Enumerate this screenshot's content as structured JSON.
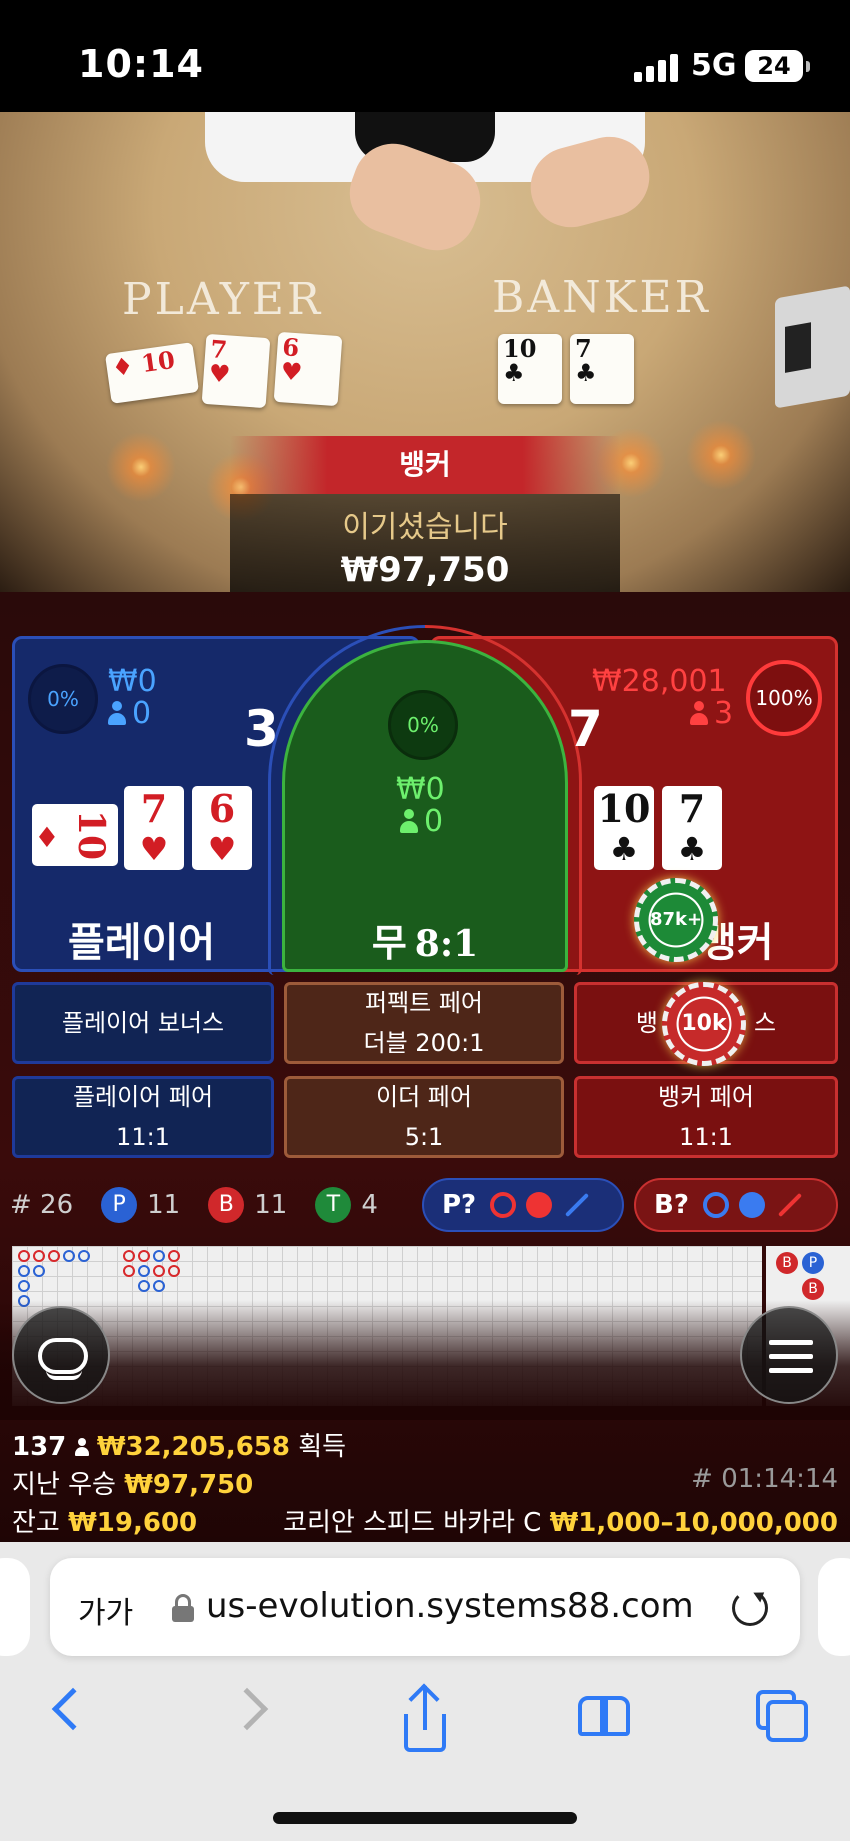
{
  "status_bar": {
    "time": "10:14",
    "network": "5G",
    "battery": "24"
  },
  "video": {
    "player_label": "PLAYER",
    "banker_label": "BANKER",
    "player_cards": [
      {
        "rank": "10",
        "suit": "♦",
        "color": "red"
      },
      {
        "rank": "7",
        "suit": "♥",
        "color": "red"
      },
      {
        "rank": "6",
        "suit": "♥",
        "color": "red"
      }
    ],
    "banker_cards": [
      {
        "rank": "10",
        "suit": "♣",
        "color": "black"
      },
      {
        "rank": "7",
        "suit": "♣",
        "color": "black"
      }
    ],
    "result_winner": "뱅커",
    "result_message": "이기셨습니다",
    "result_amount": "₩97,750"
  },
  "player_box": {
    "percent": "0%",
    "amount": "₩0",
    "count": "0",
    "score": "3",
    "title": "플레이어",
    "cards": [
      {
        "rank": "10",
        "suit": "♦"
      },
      {
        "rank": "7",
        "suit": "♥"
      },
      {
        "rank": "6",
        "suit": "♥"
      }
    ]
  },
  "tie_box": {
    "percent": "0%",
    "amount": "₩0",
    "count": "0",
    "title": "무",
    "odds": "8:1"
  },
  "banker_box": {
    "percent": "100%",
    "amount": "₩28,001",
    "count": "3",
    "score": "7",
    "title": "뱅커",
    "cards": [
      {
        "rank": "10",
        "suit": "♣"
      },
      {
        "rank": "7",
        "suit": "♣"
      }
    ],
    "chip_label": "87k+"
  },
  "side_bets": {
    "player_bonus": "플레이어 보너스",
    "perfect_pair": "퍼펙트 페어",
    "perfect_pair_odds": "더블 200:1",
    "banker_bonus_prefix": "뱅",
    "banker_bonus_suffix": "스",
    "banker_bonus_chip": "10k",
    "player_pair": "플레이어 페어",
    "player_pair_odds": "11:1",
    "either_pair": "이더 페어",
    "either_pair_odds": "5:1",
    "banker_pair": "뱅커 페어",
    "banker_pair_odds": "11:1"
  },
  "road_stats": {
    "round_number": "# 26",
    "p_badge": "P",
    "p_count": "11",
    "b_badge": "B",
    "b_count": "11",
    "t_badge": "T",
    "t_count": "4",
    "p_predict": "P?",
    "b_predict": "B?"
  },
  "roadmap_side_labels": [
    "B",
    "P",
    "B"
  ],
  "info": {
    "players": "137",
    "total_won": "₩32,205,658",
    "won_label": "획득",
    "last_win_label": "지난 우승",
    "last_win_amount": "₩97,750",
    "game_time": "# 01:14:14",
    "balance_label": "잔고",
    "balance_amount": "₩19,600",
    "table_name": "코리안 스피드 바카라 C",
    "limits": "₩1,000–10,000,000"
  },
  "browser": {
    "text_size": "가가",
    "url": "us-evolution.systems88.com"
  },
  "colors": {
    "player_blue": "#15296a",
    "banker_red": "#8e1414",
    "tie_green": "#1a5c1c",
    "gold": "#ffd23c",
    "safari_blue": "#2f7af6"
  }
}
